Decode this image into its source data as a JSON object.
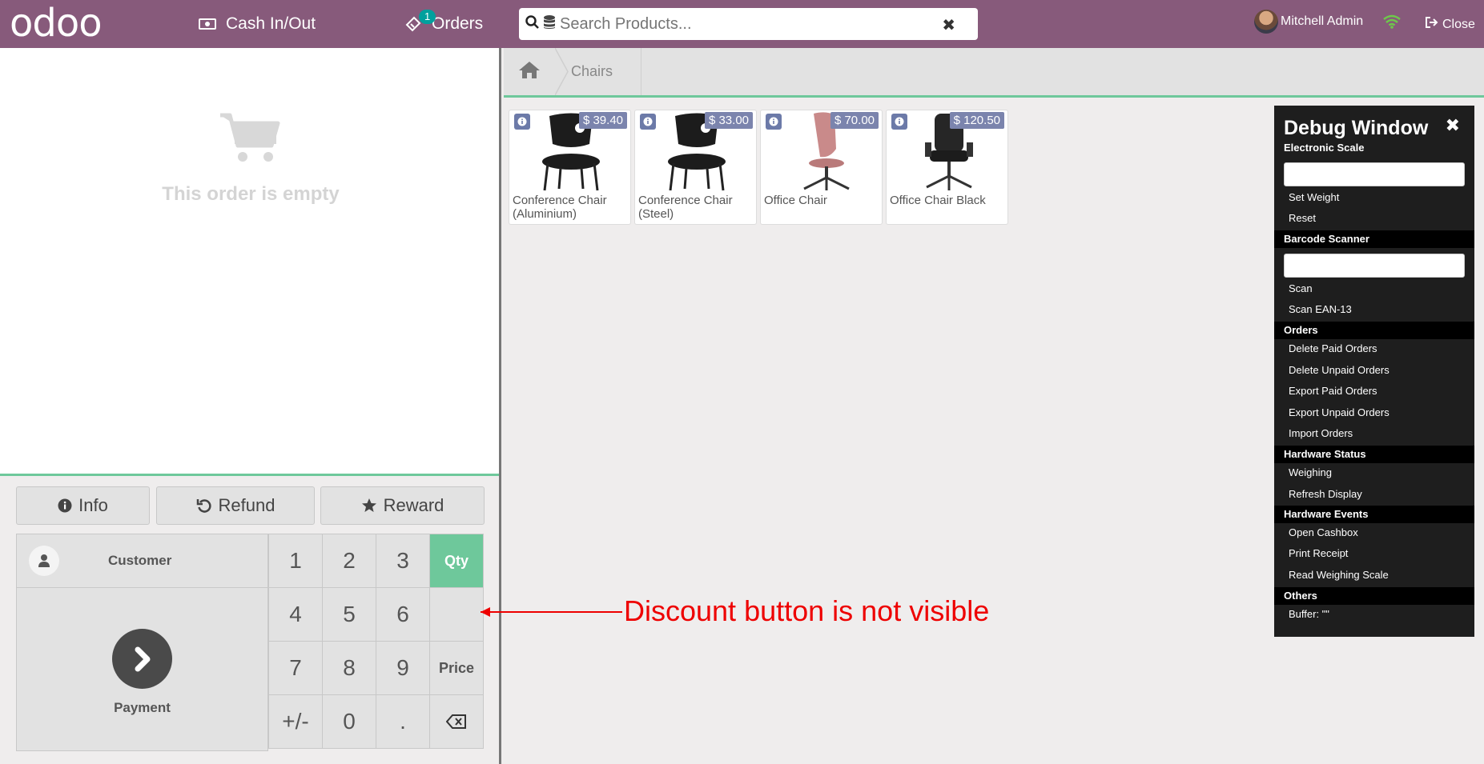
{
  "header": {
    "logo": "odoo",
    "cash_label": "Cash In/Out",
    "orders_label": "Orders",
    "orders_count": "1",
    "search_placeholder": "Search Products...",
    "user_name": "Mitchell Admin",
    "close_label": "Close"
  },
  "order": {
    "empty_text": "This order is empty"
  },
  "controls": {
    "info": "Info",
    "refund": "Refund",
    "reward": "Reward",
    "customer": "Customer",
    "payment": "Payment"
  },
  "numpad": {
    "keys": [
      "1",
      "2",
      "3",
      "Qty",
      "4",
      "5",
      "6",
      "",
      "7",
      "8",
      "9",
      "Price",
      "+/-",
      "0",
      "."
    ],
    "active_mode": "Qty"
  },
  "breadcrumb": {
    "category": "Chairs"
  },
  "products": [
    {
      "name": "Conference Chair (Aluminium)",
      "price": "$ 39.40"
    },
    {
      "name": "Conference Chair (Steel)",
      "price": "$ 33.00"
    },
    {
      "name": "Office Chair",
      "price": "$ 70.00"
    },
    {
      "name": "Office Chair Black",
      "price": "$ 120.50"
    }
  ],
  "annotation": {
    "text": "Discount button is not visible"
  },
  "debug": {
    "title": "Debug Window",
    "sections": {
      "electronic_scale": "Electronic Scale",
      "barcode_scanner": "Barcode Scanner",
      "orders": "Orders",
      "hardware_status": "Hardware Status",
      "hardware_events": "Hardware Events",
      "others": "Others"
    },
    "items": {
      "set_weight": "Set Weight",
      "reset": "Reset",
      "scan": "Scan",
      "scan_ean13": "Scan EAN-13",
      "delete_paid": "Delete Paid Orders",
      "delete_unpaid": "Delete Unpaid Orders",
      "export_paid": "Export Paid Orders",
      "export_unpaid": "Export Unpaid Orders",
      "import_orders": "Import Orders",
      "weighing": "Weighing",
      "refresh_display": "Refresh Display",
      "open_cashbox": "Open Cashbox",
      "print_receipt": "Print Receipt",
      "read_scale": "Read Weighing Scale",
      "buffer": "Buffer: \"\""
    }
  },
  "colors": {
    "topbar": "#875a7b",
    "accent_green": "#6ec89b",
    "annotation_red": "#ee0000"
  }
}
